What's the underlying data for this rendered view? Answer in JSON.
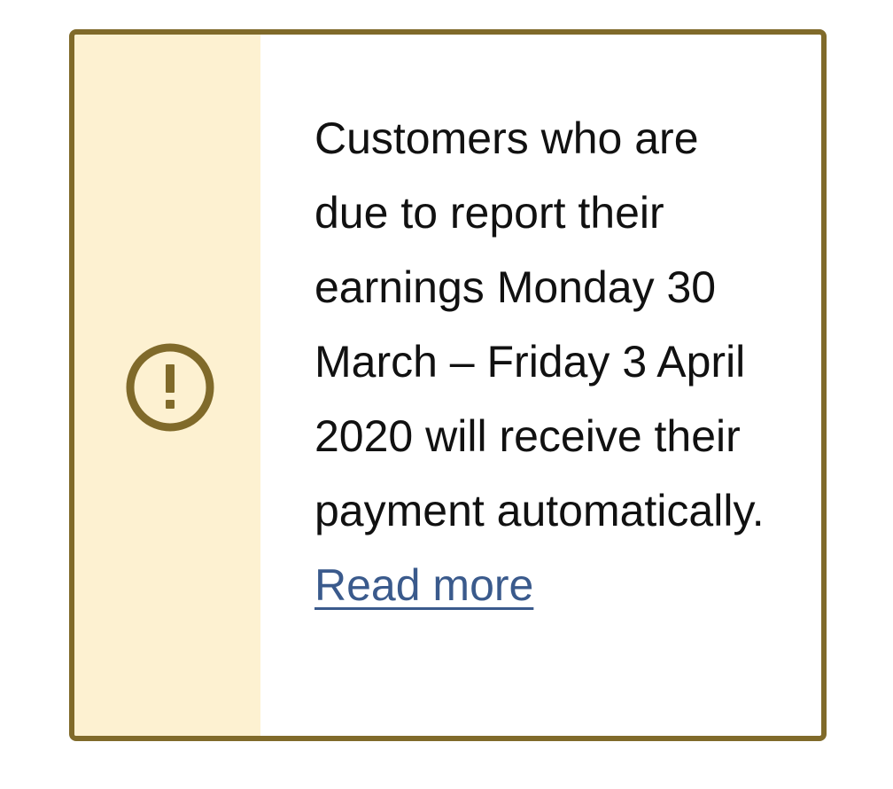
{
  "notice": {
    "message": "Customers who are due to report their earnings Monday 30 March – Friday 3 April 2020 will receive their payment automatically.",
    "link_label": "Read more",
    "icon": "exclamation-circle-icon",
    "colors": {
      "border": "#806a2a",
      "icon_panel_bg": "#fdf1d1",
      "icon": "#806a2a",
      "link": "#3a5a8c",
      "text": "#111111"
    }
  }
}
